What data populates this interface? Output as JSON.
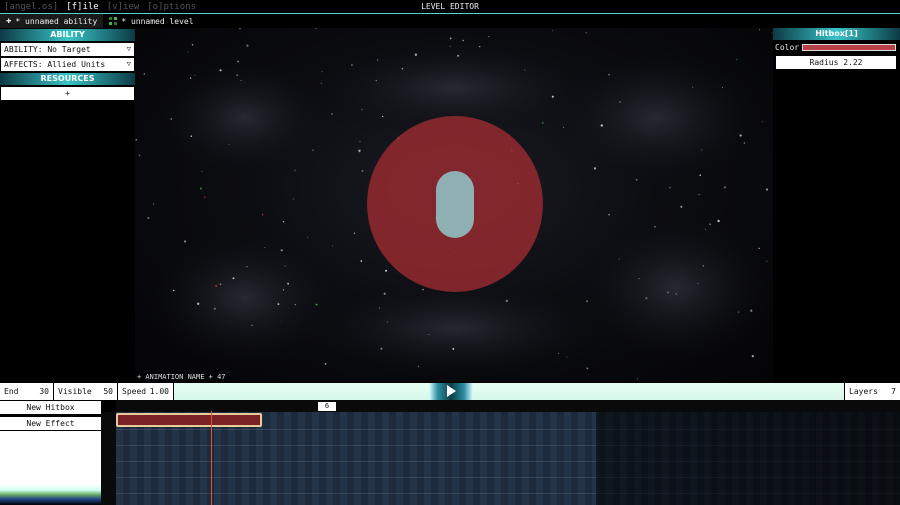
{
  "menubar": {
    "items": [
      "[angel.os]",
      "[f]ile",
      "[v]iew",
      "[o]ptions"
    ],
    "title": "LEVEL EDITOR"
  },
  "tabs": [
    {
      "label": "* unnamed ability",
      "icon": "plus-icon"
    },
    {
      "label": "* unnamed level",
      "icon": "grid-icon"
    }
  ],
  "left_panel": {
    "ability_header": "ABILITY",
    "ability_select": "ABILITY: No Target",
    "affects_select": "AFFECTS: Allied Units",
    "resources_header": "RESOURCES",
    "resource_value": "+"
  },
  "viewport": {
    "animation_label": "+ ANIMATION NAME + 47"
  },
  "right_panel": {
    "header": "Hitbox[1]",
    "color_label": "Color",
    "color_value": "#b84048",
    "radius_label": "Radius  2.22"
  },
  "controls": {
    "end_label": "End",
    "end_value": "30",
    "visible_label": "Visible",
    "visible_value": "50",
    "speed_label": "Speed",
    "speed_value": "1.00",
    "layers_label": "Layers",
    "layers_value": "7"
  },
  "timeline": {
    "new_hitbox": "New Hitbox",
    "new_effect": "New Effect",
    "current_frame": "6"
  },
  "colors": {
    "accent": "#38c4c8",
    "hitbox": "#b84048",
    "playhead": "#e0552b",
    "clip_border": "#e9c89b"
  }
}
